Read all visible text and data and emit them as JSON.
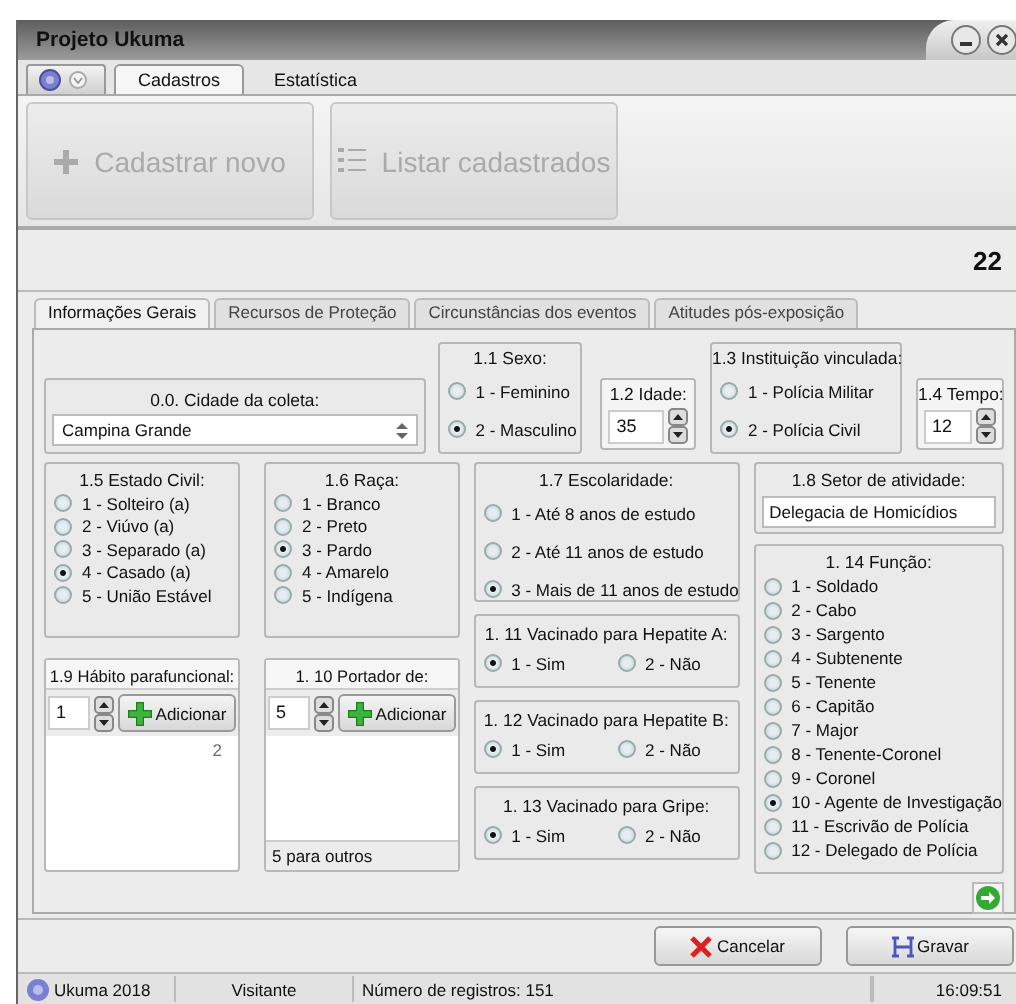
{
  "window": {
    "title": "Projeto Ukuma"
  },
  "menu_tabs": [
    {
      "label": "Cadastros",
      "selected": true
    },
    {
      "label": "Estatística",
      "selected": false
    }
  ],
  "ribbon": [
    {
      "label": "Cadastrar novo",
      "kind": "add",
      "disabled": true
    },
    {
      "label": "Listar cadastrados",
      "kind": "list",
      "disabled": true
    }
  ],
  "counter": "22",
  "form_tabs": [
    {
      "label": "Informações Gerais",
      "selected": true
    },
    {
      "label": "Recursos de Proteção",
      "selected": false
    },
    {
      "label": "Circunstâncias dos eventos",
      "selected": false
    },
    {
      "label": "Atitudes pós-exposição",
      "selected": false
    }
  ],
  "cidade": {
    "label": "0.0. Cidade da coleta:",
    "value": "Campina Grande"
  },
  "sexo": {
    "label": "1.1 Sexo:",
    "options": [
      {
        "label": "1 - Feminino",
        "selected": false
      },
      {
        "label": "2 - Masculino",
        "selected": true
      }
    ]
  },
  "idade": {
    "label": "1.2 Idade:",
    "value": "35"
  },
  "instituicao": {
    "label": "1.3 Instituição vinculada:",
    "options": [
      {
        "label": "1 - Polícia Militar",
        "selected": false
      },
      {
        "label": "2 - Polícia Civil",
        "selected": true
      }
    ]
  },
  "tempo": {
    "label": "1.4 Tempo:",
    "value": "12"
  },
  "estado_civil": {
    "label": "1.5 Estado Civil:",
    "options": [
      {
        "label": "1 - Solteiro (a)",
        "selected": false
      },
      {
        "label": "2 - Viúvo (a)",
        "selected": false
      },
      {
        "label": "3 - Separado (a)",
        "selected": false
      },
      {
        "label": "4 - Casado (a)",
        "selected": true
      },
      {
        "label": "5 - União Estável",
        "selected": false
      }
    ]
  },
  "raca": {
    "label": "1.6 Raça:",
    "options": [
      {
        "label": "1 - Branco",
        "selected": false
      },
      {
        "label": "2 - Preto",
        "selected": false
      },
      {
        "label": "3 - Pardo",
        "selected": true
      },
      {
        "label": "4 - Amarelo",
        "selected": false
      },
      {
        "label": "5 - Indígena",
        "selected": false
      }
    ]
  },
  "escolaridade": {
    "label": "1.7 Escolaridade:",
    "options": [
      {
        "label": "1 - Até 8 anos de estudo",
        "selected": false
      },
      {
        "label": "2 - Até 11 anos de estudo",
        "selected": false
      },
      {
        "label": "3 - Mais de 11 anos de estudo",
        "selected": true
      }
    ]
  },
  "setor": {
    "label": "1.8 Setor de atividade:",
    "value": "Delegacia de Homicídios"
  },
  "habito": {
    "label": "1.9 Hábito parafuncional:",
    "value": "1",
    "button": "Adicionar",
    "items": [
      "2"
    ]
  },
  "portador": {
    "label": "1. 10 Portador de:",
    "value": "5",
    "button": "Adicionar",
    "footer": "5 para outros"
  },
  "hepatite_a": {
    "label": "1. 11 Vacinado para Hepatite A:",
    "options": [
      {
        "label": "1 - Sim",
        "selected": true
      },
      {
        "label": "2 - Não",
        "selected": false
      }
    ]
  },
  "hepatite_b": {
    "label": "1. 12 Vacinado para Hepatite B:",
    "options": [
      {
        "label": "1 - Sim",
        "selected": true
      },
      {
        "label": "2 - Não",
        "selected": false
      }
    ]
  },
  "gripe": {
    "label": "1. 13 Vacinado para Gripe:",
    "options": [
      {
        "label": "1 - Sim",
        "selected": true
      },
      {
        "label": "2 - Não",
        "selected": false
      }
    ]
  },
  "funcao": {
    "label": "1. 14 Função:",
    "options": [
      {
        "label": "1 - Soldado",
        "selected": false
      },
      {
        "label": "2 - Cabo",
        "selected": false
      },
      {
        "label": "3 - Sargento",
        "selected": false
      },
      {
        "label": "4 - Subtenente",
        "selected": false
      },
      {
        "label": "5 - Tenente",
        "selected": false
      },
      {
        "label": "6 - Capitão",
        "selected": false
      },
      {
        "label": "7 - Major",
        "selected": false
      },
      {
        "label": "8 - Tenente-Coronel",
        "selected": false
      },
      {
        "label": "9 - Coronel",
        "selected": false
      },
      {
        "label": "10 - Agente de Investigação",
        "selected": true
      },
      {
        "label": "11 - Escrivão de Polícia",
        "selected": false
      },
      {
        "label": "12 - Delegado de Polícia",
        "selected": false
      }
    ]
  },
  "buttons": [
    {
      "label": "Cancelar",
      "kind": "cancel"
    },
    {
      "label": "Gravar",
      "kind": "save"
    }
  ],
  "status_bar": [
    {
      "text": "Ukuma 2018",
      "kind": "app"
    },
    {
      "text": "Visitante",
      "kind": "user"
    },
    {
      "text": "Número de registros: 151",
      "kind": "count"
    },
    {
      "text": "16:09:51",
      "kind": "clock"
    }
  ]
}
